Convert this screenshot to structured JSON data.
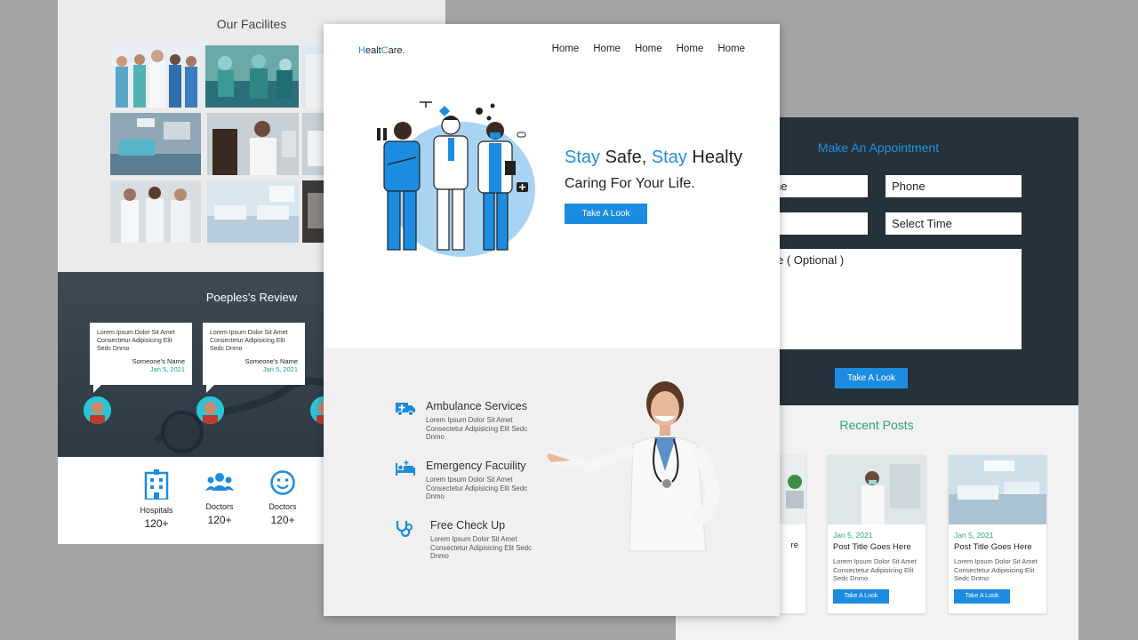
{
  "left_card": {
    "facilities_title": "Our Facilites",
    "reviews_title": "Poeples's Review",
    "reviews": [
      {
        "text": "Lorem Ipsum Dolor Sit Amet Consectetur Adipisicing Elit Sedc Dnmo",
        "name": "Someone's Name",
        "date": "Jan 5, 2021"
      },
      {
        "text": "Lorem Ipsum Dolor Sit Amet Consectetur Adipisicing Elit Sedc Dnmo",
        "name": "Someone's Name",
        "date": "Jan 5, 2021"
      }
    ],
    "stats": [
      {
        "label": "Hospitals",
        "value": "120+",
        "icon": "hospital-icon"
      },
      {
        "label": "Doctors",
        "value": "120+",
        "icon": "people-icon"
      },
      {
        "label": "Doctors",
        "value": "120+",
        "icon": "smiley-icon"
      }
    ]
  },
  "center_card": {
    "logo_h": "H",
    "logo_mid": "ealt",
    "logo_c": "C",
    "logo_end": "are.",
    "nav": [
      "Home",
      "Home",
      "Home",
      "Home",
      "Home"
    ],
    "hero": {
      "stay1": "Stay",
      "safe": " Safe, ",
      "stay2": "Stay",
      "healty": " Healty",
      "subtitle": "Caring For Your Life.",
      "button": "Take A Look"
    },
    "services": [
      {
        "title": "Ambulance Services",
        "text": "Lorem Ipsum Dolor Sit Amet Consectetur Adipisicing Elit Sedc Dnmo",
        "icon": "ambulance-icon"
      },
      {
        "title": "Emergency Facuility",
        "text": "Lorem Ipsum Dolor Sit Amet Consectetur Adipisicing Elit Sedc Dnmo",
        "icon": "bed-icon"
      },
      {
        "title": "Free Check Up",
        "text": "Lorem Ipsum Dolor Sit Amet Consectetur Adipisicing Elit Sedc Dnmo",
        "icon": "stethoscope-icon"
      }
    ]
  },
  "right_card": {
    "appointment_title": "Make An Appointment",
    "fields": {
      "name_partial": "ne",
      "phone": "Phone",
      "select_time": "Select Time",
      "message_partial": "e ( Optional )"
    },
    "submit_button": "Take A Look",
    "posts_title": "Recent Posts",
    "partial_post": {
      "title_partial": "re",
      "text_partial": "ır\nit\ni"
    },
    "posts": [
      {
        "date": "Jan 5, 2021",
        "title": "Post Title Goes Here",
        "text": "Lorem Ipsum Dolor Sit Amet Consectetur Adipisicing Elit Sedc Dnmo",
        "button": "Take A Look"
      },
      {
        "date": "Jan 5, 2021",
        "title": "Post Title Goes Here",
        "text": "Lorem Ipsum Dolor Sit Amet Consectetur Adipisicing Elit Sedc Dnmo",
        "button": "Take A Look"
      }
    ]
  },
  "colors": {
    "accent_blue": "#1e8fe0",
    "accent_green": "#2ea36d",
    "dark_band": "#26323a",
    "background": "#a4a4a4"
  }
}
